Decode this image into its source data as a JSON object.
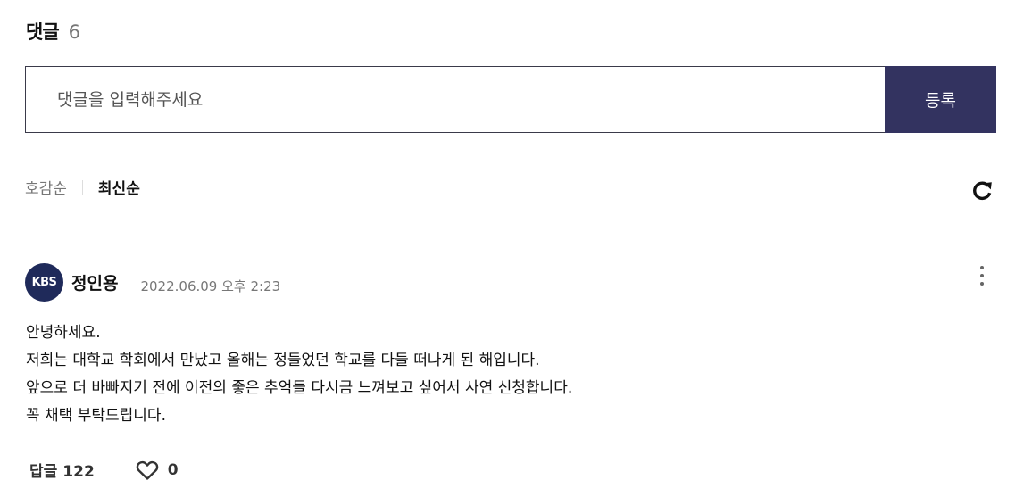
{
  "comments": {
    "title": "댓글",
    "count": "6",
    "input_placeholder": "댓글을 입력해주세요",
    "submit_label": "등록",
    "sort": {
      "options": [
        "호감순",
        "최신순"
      ],
      "selected": "최신순"
    },
    "icons": {
      "refresh": "refresh-icon",
      "more": "more-vertical-icon",
      "like": "heart-icon"
    },
    "colors": {
      "submit_bg": "#333360",
      "avatar_bg": "#1f2a5a"
    },
    "item": {
      "avatar_text": "KBS",
      "author": "정인용",
      "date": "2022.06.09 오후 2:23",
      "lines": [
        "안녕하세요.",
        "저희는 대학교 학회에서 만났고 올해는 정들었던 학교를 다들 떠나게 된 해입니다.",
        "앞으로 더 바빠지기 전에 이전의 좋은 추억들 다시금 느껴보고 싶어서 사연 신청합니다.",
        "꼭 채택 부탁드립니다."
      ],
      "reply_label": "답글",
      "reply_count": "122",
      "like_count": "0"
    }
  }
}
